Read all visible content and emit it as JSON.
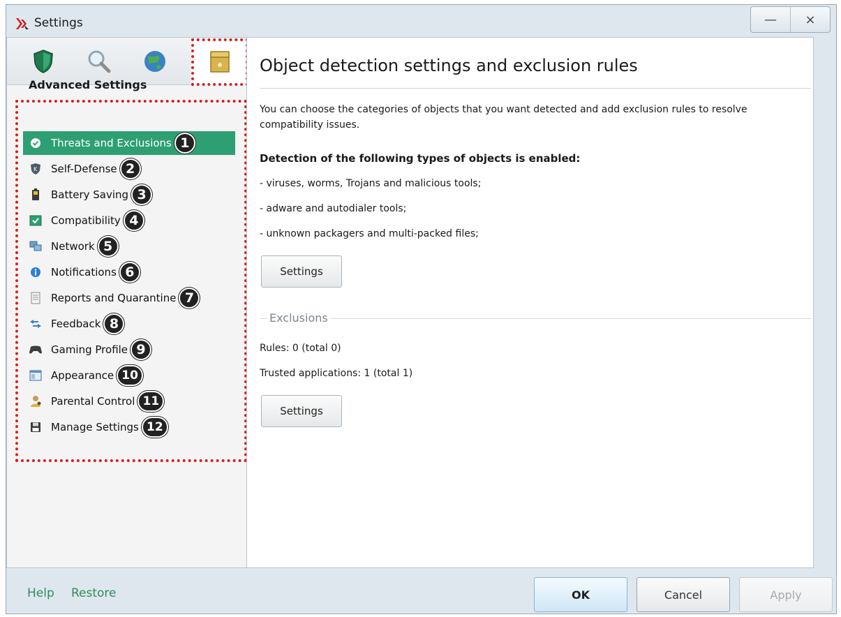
{
  "window": {
    "title": "Settings",
    "minimize_glyph": "—",
    "close_glyph": "×"
  },
  "icon_strip": [
    {
      "name": "protection-shield-icon"
    },
    {
      "name": "scan-magnifier-icon"
    },
    {
      "name": "update-globe-icon"
    },
    {
      "name": "advanced-settings-box-icon",
      "selected": true
    }
  ],
  "sidebar": {
    "heading": "Advanced Settings",
    "items": [
      {
        "label": "Threats and Exclusions",
        "badge": "1",
        "icon": "check-circle-icon"
      },
      {
        "label": "Self-Defense",
        "badge": "2",
        "icon": "kaspersky-shield-icon"
      },
      {
        "label": "Battery Saving",
        "badge": "3",
        "icon": "battery-icon"
      },
      {
        "label": "Compatibility",
        "badge": "4",
        "icon": "compatibility-check-icon"
      },
      {
        "label": "Network",
        "badge": "5",
        "icon": "network-computers-icon"
      },
      {
        "label": "Notifications",
        "badge": "6",
        "icon": "info-icon"
      },
      {
        "label": "Reports and Quarantine",
        "badge": "7",
        "icon": "report-document-icon"
      },
      {
        "label": "Feedback",
        "badge": "8",
        "icon": "feedback-arrows-icon"
      },
      {
        "label": "Gaming Profile",
        "badge": "9",
        "icon": "gamepad-icon"
      },
      {
        "label": "Appearance",
        "badge": "10",
        "icon": "appearance-window-icon"
      },
      {
        "label": "Parental Control",
        "badge": "11",
        "icon": "parental-control-icon"
      },
      {
        "label": "Manage Settings",
        "badge": "12",
        "icon": "floppy-disk-icon"
      }
    ]
  },
  "main": {
    "title": "Object detection settings and exclusion rules",
    "description": "You can choose the categories of objects that you want detected and add exclusion rules to resolve compatibility issues.",
    "detection_heading": "Detection of the following types of objects is enabled:",
    "detection_items": [
      "- viruses, worms, Trojans and malicious tools;",
      "- adware and autodialer tools;",
      "- unknown packagers and multi-packed files;"
    ],
    "detection_settings_button": "Settings",
    "exclusions_section": "Exclusions",
    "rules_text": "Rules: 0 (total 0)",
    "trusted_text": "Trusted applications: 1 (total 1)",
    "exclusions_settings_button": "Settings"
  },
  "footer": {
    "help": "Help",
    "restore": "Restore",
    "ok": "OK",
    "cancel": "Cancel",
    "apply": "Apply"
  },
  "colors": {
    "active_item": "#2e9f73",
    "highlight_border": "#d81e1e",
    "link": "#2f8b5b"
  }
}
